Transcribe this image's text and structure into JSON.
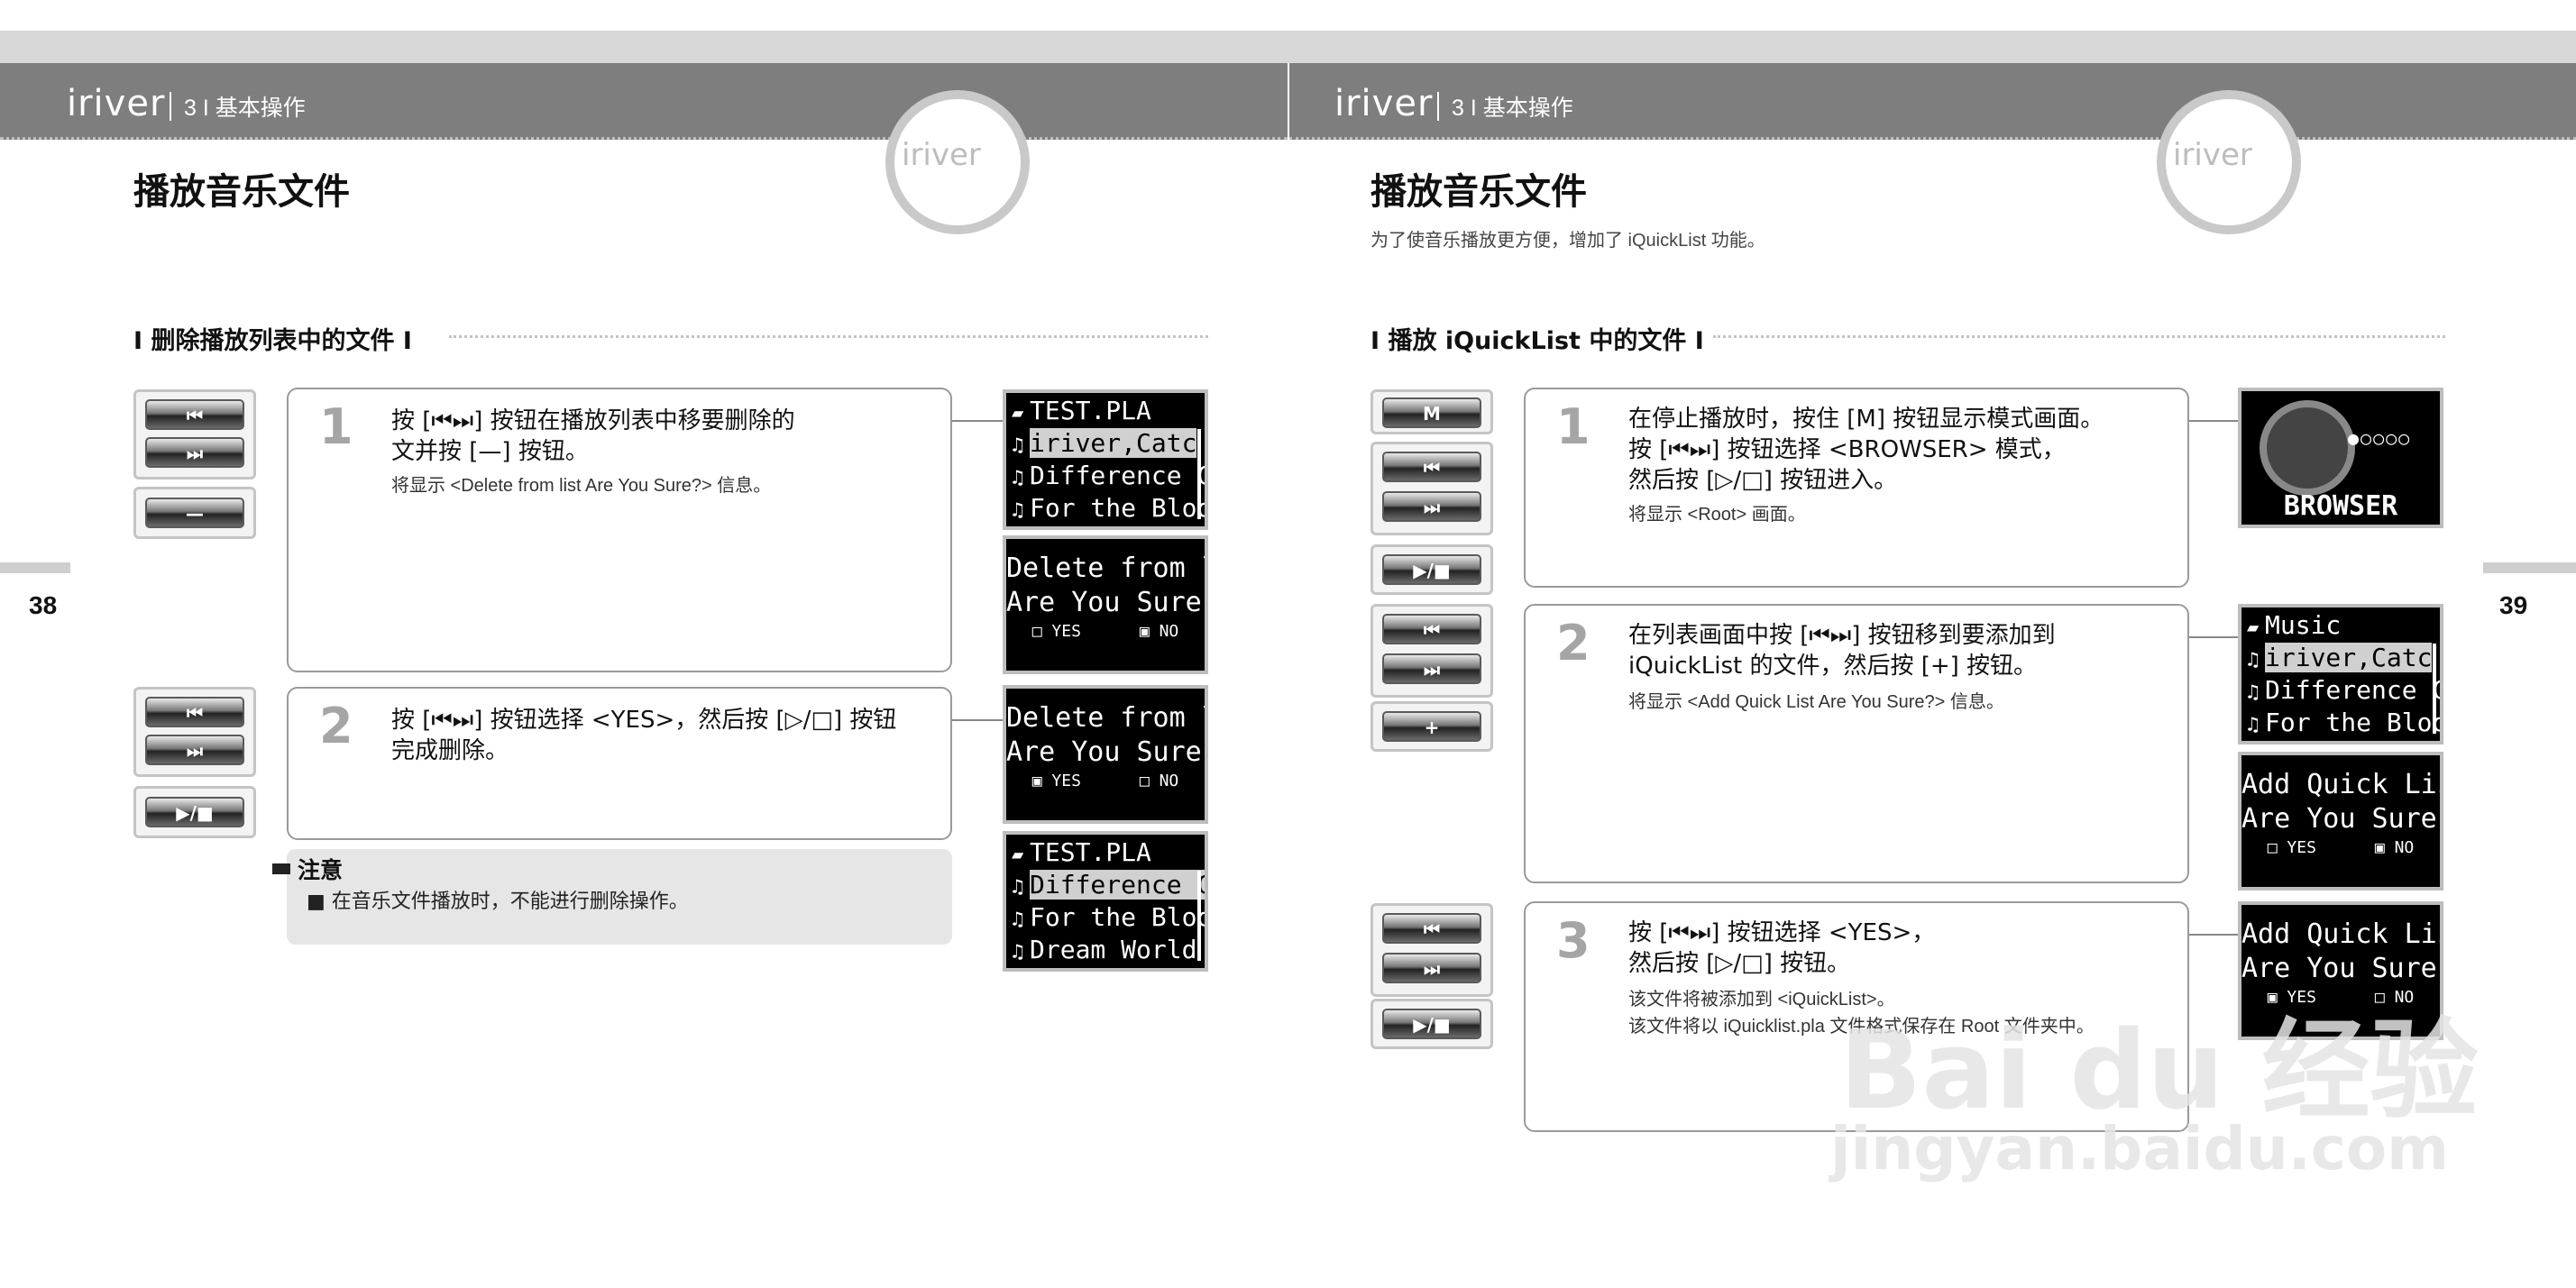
{
  "header": {
    "logo": "iriver",
    "chapter": "3 I 基本操作",
    "watermark_logo": "iriver"
  },
  "left_page": {
    "title": "播放音乐文件",
    "section": "I 删除播放列表中的文件 I",
    "page_number": "38",
    "buttons": {
      "step1": [
        "⏮",
        "⏭",
        "—"
      ],
      "step2": [
        "⏮",
        "⏭",
        "▶/■"
      ]
    },
    "steps": [
      {
        "number": "1",
        "text": "按 [⏮⏭] 按钮在播放列表中移要删除的\n文并按 [—] 按钮。",
        "note": "将显示 <Delete from list Are You Sure?> 信息。"
      },
      {
        "number": "2",
        "text": "按 [⏮⏭] 按钮选择 <YES>，然后按 [▷/□] 按钮\n完成删除。",
        "note": ""
      }
    ],
    "notice": {
      "heading": "注意",
      "items": [
        "■  在音乐文件播放时，不能进行删除操作。"
      ]
    },
    "screens": {
      "list1": [
        {
          "icon": "folder",
          "text": "TEST.PLA",
          "selected": false
        },
        {
          "icon": "note",
          "text": "iriver,Catc",
          "selected": true
        },
        {
          "icon": "note",
          "text": "Difference C",
          "selected": false
        },
        {
          "icon": "note",
          "text": "For the Bloo",
          "selected": false
        }
      ],
      "dialog1": {
        "line1": "Delete from list",
        "line2": "Are You Sure?",
        "options": "□ YES      ▣ NO"
      },
      "dialog2": {
        "line1": "Delete from list",
        "line2": "Are You Sure?",
        "options": "▣ YES      □ NO"
      },
      "list2": [
        {
          "icon": "folder",
          "text": "TEST.PLA",
          "selected": false
        },
        {
          "icon": "note",
          "text": "Difference C",
          "selected": true
        },
        {
          "icon": "note",
          "text": "For the Bloo",
          "selected": false
        },
        {
          "icon": "note",
          "text": "Dream World",
          "selected": false
        }
      ]
    }
  },
  "right_page": {
    "title": "播放音乐文件",
    "subtitle": "为了使音乐播放更方便，增加了 iQuickList 功能。",
    "section": "I 播放 iQuickList 中的文件 I",
    "page_number": "39",
    "buttons": {
      "step1": [
        "M",
        "⏮",
        "⏭",
        "▶/■"
      ],
      "step2": [
        "⏮",
        "⏭",
        "+"
      ],
      "step3": [
        "⏮",
        "⏭",
        "▶/■"
      ]
    },
    "steps": [
      {
        "number": "1",
        "text": "在停止播放时，按住 [M] 按钮显示模式画面。\n按 [⏮⏭] 按钮选择 <BROWSER> 模式，\n然后按 [▷/□] 按钮进入。",
        "note": "将显示 <Root> 画面。"
      },
      {
        "number": "2",
        "text": "在列表画面中按 [⏮⏭] 按钮移到要添加到\niQuickList 的文件，然后按 [+] 按钮。",
        "note": "将显示 <Add Quick List Are You Sure?> 信息。"
      },
      {
        "number": "3",
        "text": "按 [⏮⏭] 按钮选择 <YES>，\n然后按 [▷/□] 按钮。",
        "note": "该文件将被添加到 <iQuickList>。\n该文件将以 iQuicklist.pla 文件格式保存在 Root 文件夹中。"
      }
    ],
    "screens": {
      "browser": {
        "label": "BROWSER",
        "dots": "●○○○○"
      },
      "list": [
        {
          "icon": "folder",
          "text": "Music",
          "selected": false
        },
        {
          "icon": "note",
          "text": "iriver,Catc",
          "selected": true
        },
        {
          "icon": "note",
          "text": "Difference C",
          "selected": false
        },
        {
          "icon": "note",
          "text": "For the Bloo",
          "selected": false
        }
      ],
      "dialog1": {
        "line1": "Add Quick List",
        "line2": "Are You Sure?",
        "options": "□ YES      ▣ NO"
      },
      "dialog2": {
        "line1": "Add Quick List",
        "line2": "Are You Sure?",
        "options": "▣ YES      □ NO"
      }
    }
  },
  "watermark": {
    "brand": "Bai du 经验",
    "url": "jingyan.baidu.com"
  }
}
